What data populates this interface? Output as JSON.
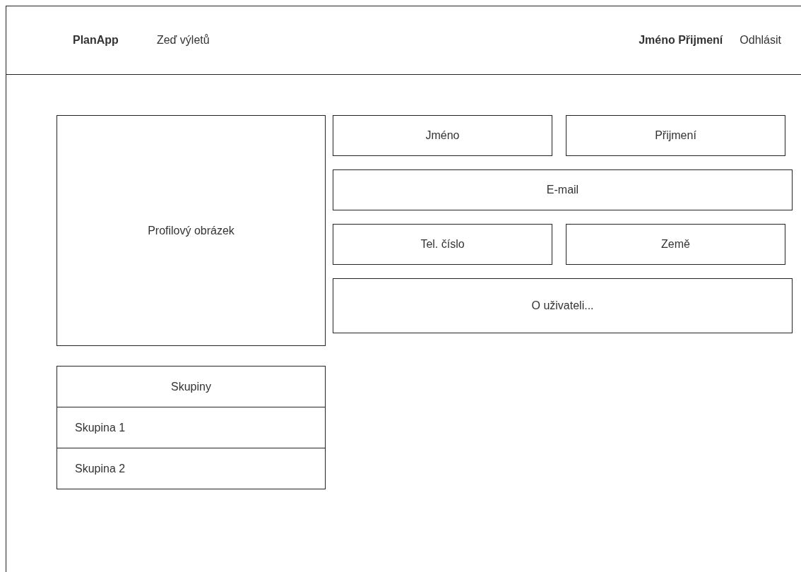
{
  "navbar": {
    "brand": "PlanApp",
    "links": [
      {
        "label": "Zeď výletů"
      }
    ],
    "user_name": "Jméno Přijmení",
    "logout": "Odhlásit"
  },
  "profile_picture": {
    "label": "Profilový obrázek"
  },
  "fields": [
    {
      "label": "Jméno",
      "kind": "half"
    },
    {
      "label": "Přijmení",
      "kind": "half"
    },
    {
      "label": "E-mail",
      "kind": "full"
    },
    {
      "label": "Tel. číslo",
      "kind": "half"
    },
    {
      "label": "Země",
      "kind": "half"
    },
    {
      "label": "O uživateli...",
      "kind": "tall"
    }
  ],
  "groups": {
    "title": "Skupiny",
    "items": [
      {
        "label": "Skupina 1"
      },
      {
        "label": "Skupina 2"
      }
    ]
  }
}
